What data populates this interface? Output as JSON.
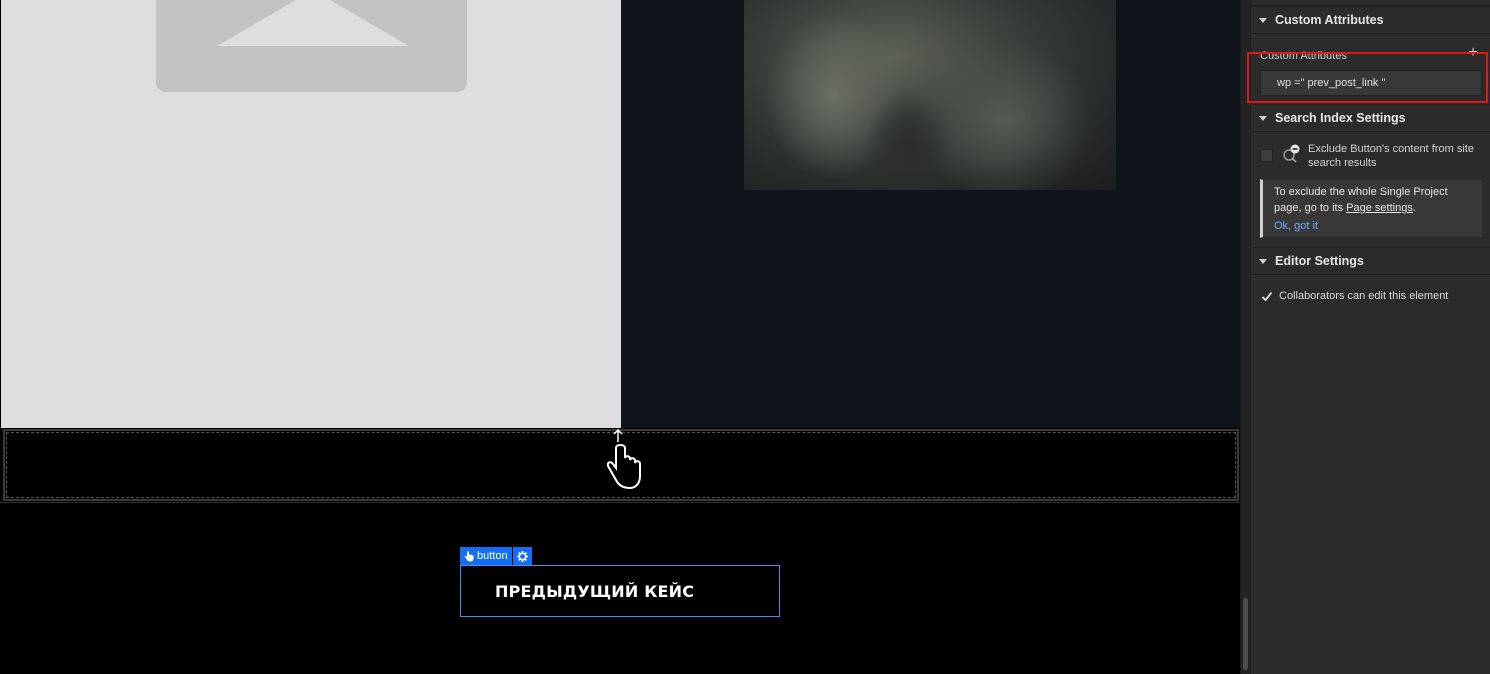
{
  "canvas": {
    "element_tag": {
      "label": "button",
      "icon": "hand-pointer-icon",
      "settings_icon": "gear-icon"
    },
    "button_text": "ПРЕДЫДУЩИЙ КЕЙС"
  },
  "panel": {
    "custom_attributes": {
      "title": "Custom Attributes",
      "field_label": "Custom Attributes",
      "attribute_value": "wp =\" prev_post_link \""
    },
    "search_index": {
      "title": "Search Index Settings",
      "exclude_label": "Exclude Button's content from site search results",
      "info_prefix": "To exclude the whole Single Project page, go to its ",
      "info_link": "Page settings",
      "info_suffix": ".",
      "ok_link": "Ok, got it"
    },
    "editor": {
      "title": "Editor Settings",
      "collaborators_label": "Collaborators can edit this element",
      "collaborators_checked": true
    }
  },
  "colors": {
    "accent": "#146ef5",
    "highlight": "#e01818",
    "link": "#6ea8ff"
  }
}
